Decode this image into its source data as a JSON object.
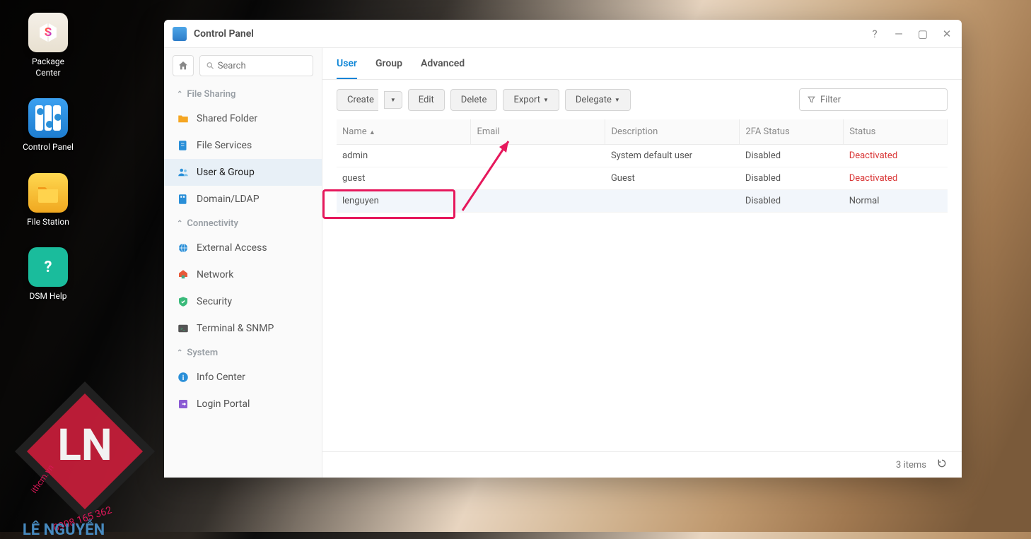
{
  "desktop": {
    "items": [
      {
        "label": "Package\nCenter"
      },
      {
        "label": "Control Panel"
      },
      {
        "label": "File Station"
      },
      {
        "label": "DSM Help"
      }
    ]
  },
  "window": {
    "title": "Control Panel",
    "search_placeholder": "Search",
    "sidebar": {
      "cat1": "File Sharing",
      "cat2": "Connectivity",
      "cat3": "System",
      "items": {
        "shared_folder": "Shared Folder",
        "file_services": "File Services",
        "user_group": "User & Group",
        "domain_ldap": "Domain/LDAP",
        "external_access": "External Access",
        "network": "Network",
        "security": "Security",
        "terminal": "Terminal & SNMP",
        "info_center": "Info Center",
        "login_portal": "Login Portal"
      }
    },
    "tabs": {
      "user": "User",
      "group": "Group",
      "advanced": "Advanced"
    },
    "toolbar": {
      "create": "Create",
      "edit": "Edit",
      "delete": "Delete",
      "export": "Export",
      "delegate": "Delegate"
    },
    "filter_placeholder": "Filter",
    "columns": {
      "name": "Name",
      "email": "Email",
      "desc": "Description",
      "twofa": "2FA Status",
      "status": "Status"
    },
    "rows": [
      {
        "name": "admin",
        "email": "",
        "desc": "System default user",
        "twofa": "Disabled",
        "status": "Deactivated",
        "status_color": "deact"
      },
      {
        "name": "guest",
        "email": "",
        "desc": "Guest",
        "twofa": "Disabled",
        "status": "Deactivated",
        "status_color": "deact"
      },
      {
        "name": "lenguyen",
        "email": "",
        "desc": "",
        "twofa": "Disabled",
        "status": "Normal",
        "status_color": ""
      }
    ],
    "footer": {
      "count": "3 items"
    }
  },
  "watermark": {
    "line1": "LÊ NGUYỄN",
    "line2": "ithcm.vn",
    "line3": "0908.165 362"
  }
}
